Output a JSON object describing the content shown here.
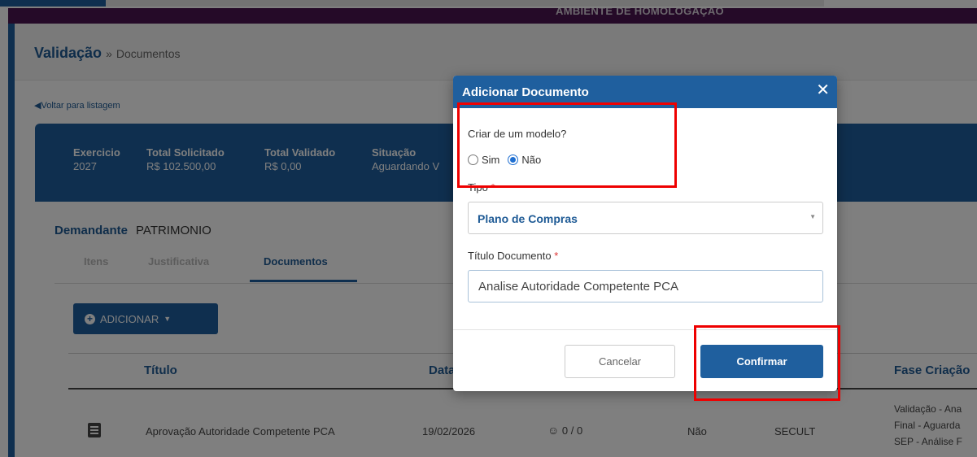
{
  "env_banner": "AMBIENTE DE HOMOLOGAÇÃO",
  "header": {
    "title": "Validação",
    "separator": "»",
    "subtitle": "Documentos"
  },
  "back_link": "Voltar para listagem",
  "summary": [
    {
      "label": "Exercicio",
      "value": "2027"
    },
    {
      "label": "Total Solicitado",
      "value": "R$ 102.500,00"
    },
    {
      "label": "Total Validado",
      "value": "R$ 0,00"
    },
    {
      "label": "Situação",
      "value": "Aguardando V"
    }
  ],
  "demandante": {
    "label": "Demandante",
    "value": "PATRIMONIO"
  },
  "tabs": [
    {
      "label": "Itens",
      "active": false
    },
    {
      "label": "Justificativa",
      "active": false
    },
    {
      "label": "Documentos",
      "active": true
    }
  ],
  "add_button": "ADICIONAR",
  "table": {
    "headers": [
      "Título",
      "Data",
      "Fase Criação"
    ],
    "rows": [
      {
        "titulo": "Aprovação Autoridade Competente PCA",
        "data": "19/02/2026",
        "assinaturas": "0 / 0",
        "flag": "Não",
        "orgao": "SECULT",
        "fase_lines": [
          "Validação - Ana",
          "Final - Aguarda",
          "SEP - Análise F"
        ]
      }
    ]
  },
  "modal": {
    "title": "Adicionar Documento",
    "close": "✕",
    "question": "Criar de um modelo?",
    "options": [
      {
        "label": "Sim",
        "checked": false
      },
      {
        "label": "Não",
        "checked": true
      }
    ],
    "tipo_label": "Tipo",
    "tipo_value": "Plano de Compras",
    "titulo_label": "Título Documento",
    "required_mark": "*",
    "titulo_value": "Analise Autoridade Competente PCA",
    "cancel": "Cancelar",
    "confirm": "Confirmar"
  },
  "colors": {
    "primary": "#1f5f9e",
    "banner": "#4b1550",
    "highlight": "#ee0000",
    "radio": "#1f6fd1"
  }
}
